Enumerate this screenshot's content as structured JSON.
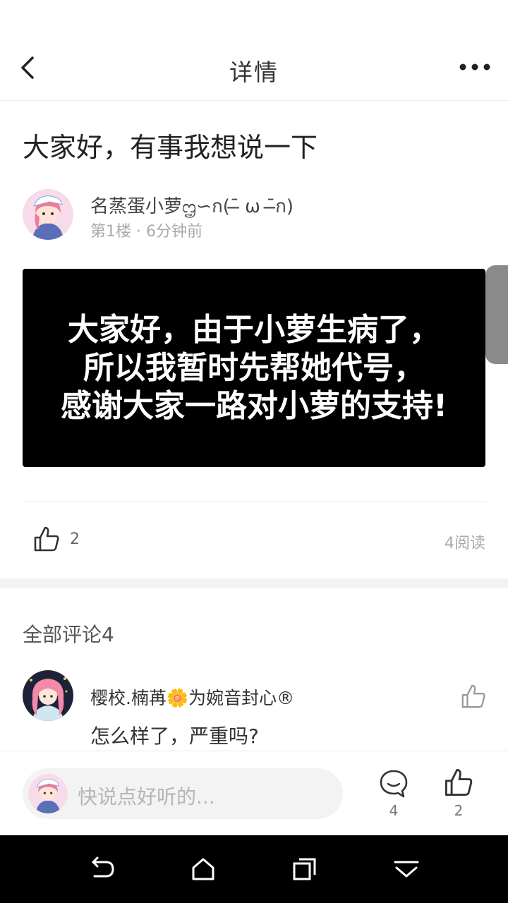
{
  "header": {
    "title": "详情",
    "back_icon": "back-chevron-icon",
    "more_icon": "more-dots-icon"
  },
  "post": {
    "title": "大家好，有事我想说一下",
    "author": {
      "name": "名蒸蛋小萝ᦗ∽ก(ˉ̶ ω ˉ̶ก)",
      "floor": "第1楼",
      "time": "6分钟前",
      "avatar_icon": "anime-avatar-icon"
    },
    "image_lines": [
      "大家好，由于小萝生病了，",
      "所以我暂时先帮她代号，",
      "感谢大家一路对小萝的支持!"
    ],
    "likes": "2",
    "reads": "4阅读"
  },
  "comments": {
    "heading": "全部评论4",
    "items": [
      {
        "name": "樱校.楠苒🌼为婉音封心®",
        "text": "怎么样了，严重吗?"
      }
    ]
  },
  "bottom_bar": {
    "placeholder": "快说点好听的...",
    "comment_count": "4",
    "like_count": "2"
  },
  "colors": {
    "accent_text": "#222222",
    "muted_text": "#aaaaaa",
    "image_bg": "#000000",
    "nav_bg": "#000000"
  }
}
